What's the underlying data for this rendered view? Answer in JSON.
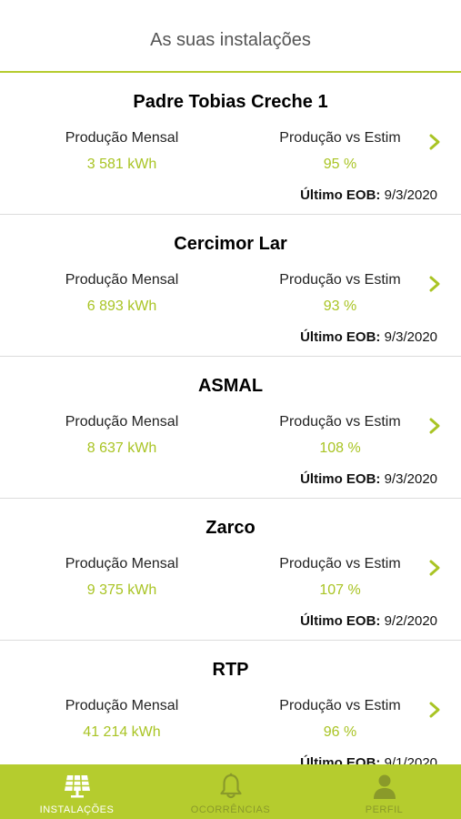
{
  "header": {
    "title": "As suas instalações"
  },
  "labels": {
    "monthly_production": "Produção Mensal",
    "production_vs_estimate": "Produção vs Estim",
    "last_eob": "Último EOB:"
  },
  "installations": [
    {
      "name": "Padre Tobias Creche 1",
      "monthly_production": "3 581 kWh",
      "production_vs_estimate": "95 %",
      "last_eob_date": "9/3/2020"
    },
    {
      "name": "Cercimor Lar",
      "monthly_production": "6 893 kWh",
      "production_vs_estimate": "93 %",
      "last_eob_date": "9/3/2020"
    },
    {
      "name": "ASMAL",
      "monthly_production": "8 637 kWh",
      "production_vs_estimate": "108 %",
      "last_eob_date": "9/3/2020"
    },
    {
      "name": "Zarco",
      "monthly_production": "9 375 kWh",
      "production_vs_estimate": "107 %",
      "last_eob_date": "9/2/2020"
    },
    {
      "name": "RTP",
      "monthly_production": "41 214 kWh",
      "production_vs_estimate": "96 %",
      "last_eob_date": "9/1/2020"
    }
  ],
  "tabbar": {
    "tabs": [
      {
        "label": "INSTALAÇÕES",
        "icon": "solar-panel-icon",
        "active": true
      },
      {
        "label": "OCORRÊNCIAS",
        "icon": "bell-icon",
        "active": false
      },
      {
        "label": "PERFIL",
        "icon": "user-icon",
        "active": false
      }
    ]
  },
  "colors": {
    "accent": "#b5cc2e",
    "value_green": "#a9c424",
    "inactive_tab_text": "#8a9a2a"
  }
}
